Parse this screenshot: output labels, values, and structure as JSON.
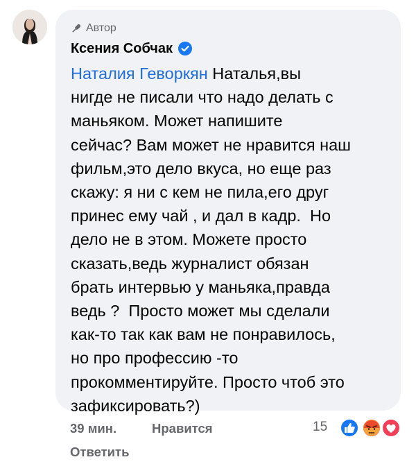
{
  "comment": {
    "author_badge_label": "Автор",
    "author_name": "Ксения Собчак",
    "mention": "Наталия Геворкян",
    "lines": [
      " Наталья,вы",
      "нигде не писали что надо делать с",
      "маньяком. Может напишите",
      "сейчас? Вам может не нравится наш",
      "фильм,это дело вкуса, но еще раз",
      "скажу: я ни с кем не пила,его друг",
      "принес ему чай , и дал в кадр.  Но",
      "дело не в этом. Можете просто",
      "сказать,ведь журналист обязан",
      "брать интервью у маньяка,правда",
      "ведь ?  Просто может мы сделали",
      "как-то так как вам не понравилось,",
      "но про профессию -то",
      "прокомментируйте. Просто чтоб это",
      "зафиксировать?)"
    ]
  },
  "footer": {
    "time": "39 мин.",
    "like_label": "Нравится",
    "reply_label": "Ответить",
    "reaction_count": "15"
  },
  "colors": {
    "bubble_bg": "#f0f2f5",
    "mention": "#216fdb",
    "meta_text": "#65676b",
    "verified_blue": "#1877f2",
    "like_blue": "#1877f2",
    "angry_orange": "#f0612f",
    "love_red": "#f33e58"
  },
  "icons": [
    "avatar",
    "microphone-icon",
    "verified-badge-icon",
    "like-reaction-icon",
    "angry-reaction-icon",
    "love-reaction-icon"
  ]
}
